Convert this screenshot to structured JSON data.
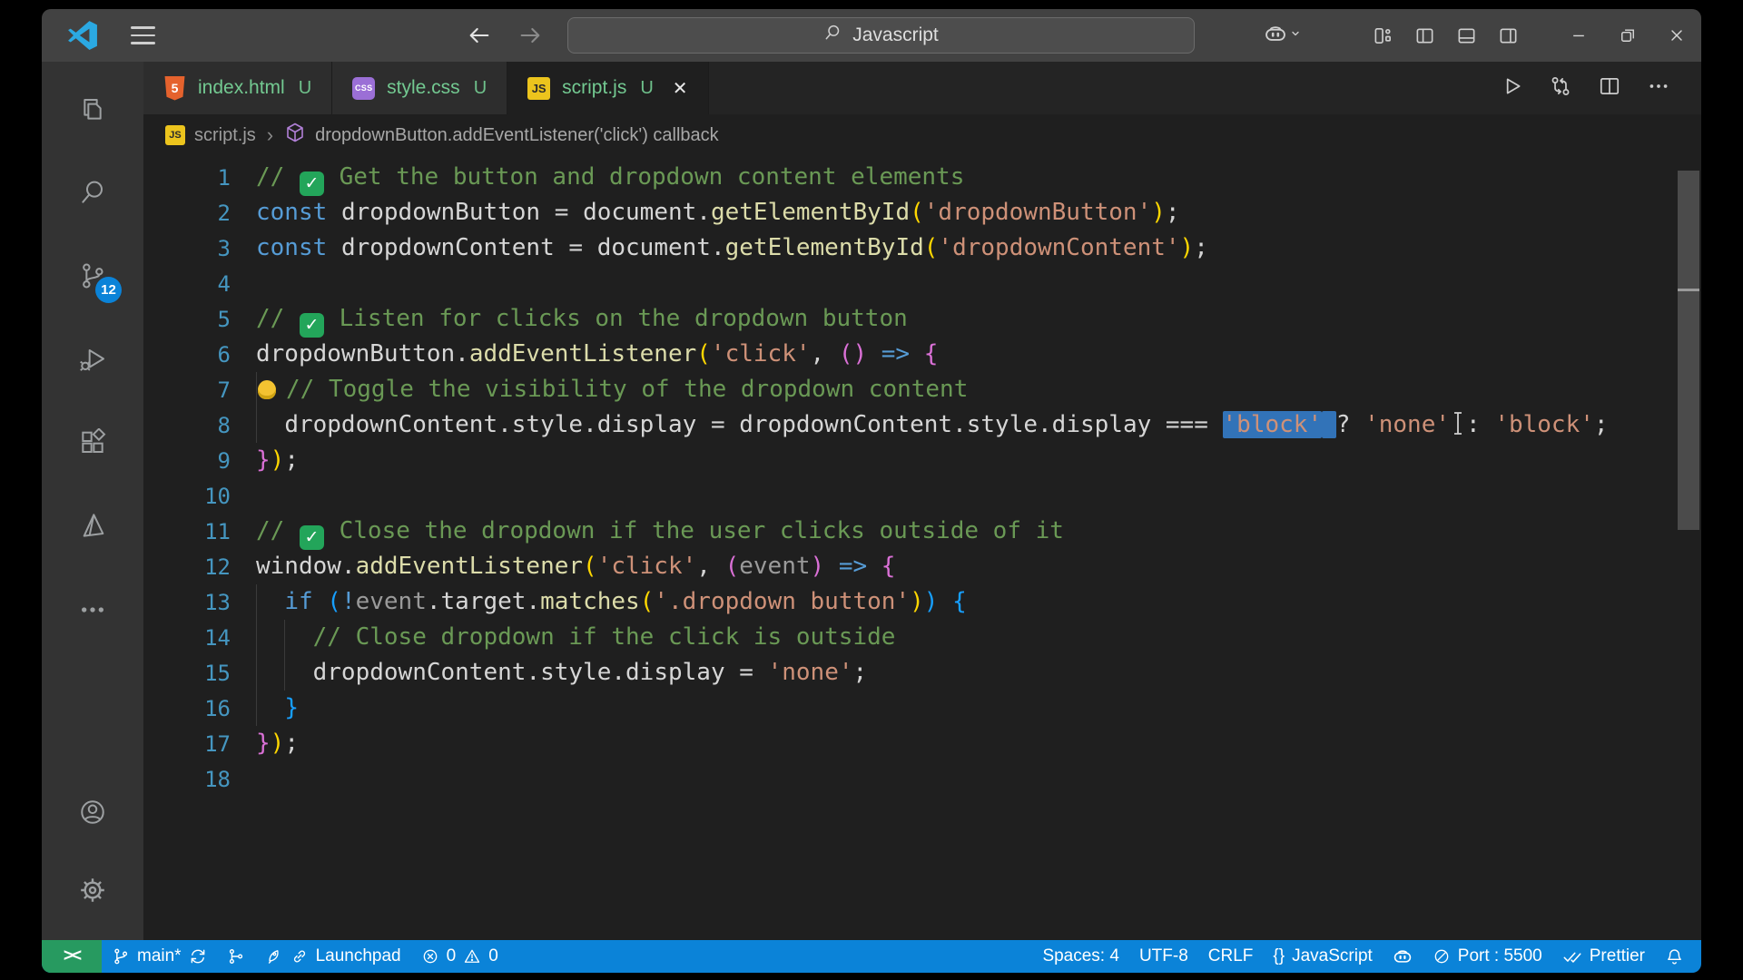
{
  "titlebar": {
    "logo": "vscode-logo",
    "menu_icon": "hamburger-menu-icon",
    "back_icon": "arrow-left-icon",
    "forward_icon": "arrow-right-icon",
    "search": {
      "icon": "search-icon",
      "label": "Javascript"
    },
    "copilot": {
      "icon": "copilot-icon",
      "chevron": "chevron-down-icon"
    },
    "layout_icons": [
      "customize-layout-icon",
      "toggle-sidebar-icon",
      "toggle-panel-icon",
      "toggle-secondary-sidebar-icon"
    ],
    "window_controls": [
      "minimize-icon",
      "restore-icon",
      "close-icon"
    ]
  },
  "activitybar": {
    "items": [
      {
        "name": "explorer",
        "icon": "files-icon"
      },
      {
        "name": "search",
        "icon": "search-icon"
      },
      {
        "name": "source-control",
        "icon": "source-control-icon",
        "badge": "12"
      },
      {
        "name": "run-debug",
        "icon": "run-debug-icon"
      },
      {
        "name": "extensions",
        "icon": "extensions-icon"
      },
      {
        "name": "prism",
        "icon": "prism-icon"
      },
      {
        "name": "more",
        "icon": "ellipsis-icon"
      }
    ],
    "bottom": [
      {
        "name": "accounts",
        "icon": "account-icon"
      },
      {
        "name": "settings",
        "icon": "gear-icon"
      }
    ]
  },
  "tabs": [
    {
      "label": "index.html",
      "status": "U",
      "icon": "html-file-icon",
      "active": false
    },
    {
      "label": "style.css",
      "status": "U",
      "icon": "css-file-icon",
      "active": false
    },
    {
      "label": "script.js",
      "status": "U",
      "icon": "js-file-icon",
      "active": true,
      "close_icon": "close-icon"
    }
  ],
  "editor_actions": [
    "run-icon",
    "open-changes-icon",
    "split-editor-icon",
    "more-actions-icon"
  ],
  "breadcrumb": {
    "file_icon": "js-file-icon",
    "file": "script.js",
    "separator": "›",
    "symbol_icon": "symbol-cube-icon",
    "symbol": "dropdownButton.addEventListener('click') callback"
  },
  "code": {
    "lines": [
      {
        "num": "1",
        "tokens": [
          {
            "t": "// ",
            "c": "cmt"
          },
          {
            "icon": "check"
          },
          {
            "t": " Get the button and dropdown content elements",
            "c": "cmt"
          }
        ]
      },
      {
        "num": "2",
        "tokens": [
          {
            "t": "const",
            "c": "kw"
          },
          {
            "t": " ",
            "c": "op"
          },
          {
            "t": "dropdownButton",
            "c": "var"
          },
          {
            "t": " = ",
            "c": "op"
          },
          {
            "t": "document",
            "c": "var"
          },
          {
            "t": ".",
            "c": "op"
          },
          {
            "t": "getElementById",
            "c": "fn"
          },
          {
            "t": "(",
            "c": "p1"
          },
          {
            "t": "'dropdownButton'",
            "c": "str"
          },
          {
            "t": ")",
            "c": "p1"
          },
          {
            "t": ";",
            "c": "op"
          }
        ]
      },
      {
        "num": "3",
        "tokens": [
          {
            "t": "const",
            "c": "kw"
          },
          {
            "t": " ",
            "c": "op"
          },
          {
            "t": "dropdownContent",
            "c": "var"
          },
          {
            "t": " = ",
            "c": "op"
          },
          {
            "t": "document",
            "c": "var"
          },
          {
            "t": ".",
            "c": "op"
          },
          {
            "t": "getElementById",
            "c": "fn"
          },
          {
            "t": "(",
            "c": "p1"
          },
          {
            "t": "'dropdownContent'",
            "c": "str"
          },
          {
            "t": ")",
            "c": "p1"
          },
          {
            "t": ";",
            "c": "op"
          }
        ]
      },
      {
        "num": "4",
        "tokens": []
      },
      {
        "num": "5",
        "tokens": [
          {
            "t": "// ",
            "c": "cmt"
          },
          {
            "icon": "check"
          },
          {
            "t": " Listen for clicks on the dropdown button",
            "c": "cmt"
          }
        ]
      },
      {
        "num": "6",
        "tokens": [
          {
            "t": "dropdownButton",
            "c": "var"
          },
          {
            "t": ".",
            "c": "op"
          },
          {
            "t": "addEventListener",
            "c": "fn"
          },
          {
            "t": "(",
            "c": "p1"
          },
          {
            "t": "'click'",
            "c": "str"
          },
          {
            "t": ", ",
            "c": "op"
          },
          {
            "t": "()",
            "c": "p2"
          },
          {
            "t": " ",
            "c": "op"
          },
          {
            "t": "=>",
            "c": "arrow"
          },
          {
            "t": " ",
            "c": "op"
          },
          {
            "t": "{",
            "c": "p2"
          }
        ]
      },
      {
        "num": "7",
        "g": [
          0
        ],
        "tokens": [
          {
            "icon": "bulb"
          },
          {
            "t": "// Toggle the visibility of the dropdown content",
            "c": "cmt"
          }
        ]
      },
      {
        "num": "8",
        "g": [
          0
        ],
        "tokens": [
          {
            "t": "  ",
            "c": "op"
          },
          {
            "t": "dropdownContent",
            "c": "var"
          },
          {
            "t": ".",
            "c": "op"
          },
          {
            "t": "style",
            "c": "var"
          },
          {
            "t": ".",
            "c": "op"
          },
          {
            "t": "display",
            "c": "var"
          },
          {
            "t": " = ",
            "c": "op"
          },
          {
            "t": "dropdownContent",
            "c": "var"
          },
          {
            "t": ".",
            "c": "op"
          },
          {
            "t": "style",
            "c": "var"
          },
          {
            "t": ".",
            "c": "op"
          },
          {
            "t": "display",
            "c": "var"
          },
          {
            "t": " ",
            "c": "op"
          },
          {
            "t": "===",
            "c": "op"
          },
          {
            "t": " ",
            "c": "op"
          },
          {
            "t": "'block'",
            "c": "str",
            "sel": true
          },
          {
            "t": " ",
            "c": "op",
            "sel": true
          },
          {
            "t": "?",
            "c": "op"
          },
          {
            "t": " ",
            "c": "op"
          },
          {
            "t": "'none'",
            "c": "str"
          },
          {
            "icon": "ibeam"
          },
          {
            "t": ":",
            "c": "op"
          },
          {
            "t": " ",
            "c": "op"
          },
          {
            "t": "'block'",
            "c": "str"
          },
          {
            "t": ";",
            "c": "op"
          }
        ]
      },
      {
        "num": "9",
        "tokens": [
          {
            "t": "}",
            "c": "p2"
          },
          {
            "t": ")",
            "c": "p1"
          },
          {
            "t": ";",
            "c": "op"
          }
        ]
      },
      {
        "num": "10",
        "tokens": []
      },
      {
        "num": "11",
        "tokens": [
          {
            "t": "// ",
            "c": "cmt"
          },
          {
            "icon": "check"
          },
          {
            "t": " Close the dropdown if the user clicks outside of it",
            "c": "cmt"
          }
        ]
      },
      {
        "num": "12",
        "tokens": [
          {
            "t": "window",
            "c": "var"
          },
          {
            "t": ".",
            "c": "op"
          },
          {
            "t": "addEventListener",
            "c": "fn"
          },
          {
            "t": "(",
            "c": "p1"
          },
          {
            "t": "'click'",
            "c": "str"
          },
          {
            "t": ", ",
            "c": "op"
          },
          {
            "t": "(",
            "c": "p2"
          },
          {
            "t": "event",
            "c": "param"
          },
          {
            "t": ")",
            "c": "p2"
          },
          {
            "t": " ",
            "c": "op"
          },
          {
            "t": "=>",
            "c": "arrow"
          },
          {
            "t": " ",
            "c": "op"
          },
          {
            "t": "{",
            "c": "p2"
          }
        ]
      },
      {
        "num": "13",
        "g": [
          0
        ],
        "tokens": [
          {
            "t": "  ",
            "c": "op"
          },
          {
            "t": "if",
            "c": "kw"
          },
          {
            "t": " ",
            "c": "op"
          },
          {
            "t": "(",
            "c": "p3"
          },
          {
            "t": "!",
            "c": "kw"
          },
          {
            "t": "event",
            "c": "param"
          },
          {
            "t": ".",
            "c": "op"
          },
          {
            "t": "target",
            "c": "var"
          },
          {
            "t": ".",
            "c": "op"
          },
          {
            "t": "matches",
            "c": "fn"
          },
          {
            "t": "(",
            "c": "p1"
          },
          {
            "t": "'.dropdown button'",
            "c": "str"
          },
          {
            "t": ")",
            "c": "p1"
          },
          {
            "t": ")",
            "c": "p3"
          },
          {
            "t": " ",
            "c": "op"
          },
          {
            "t": "{",
            "c": "p3"
          }
        ]
      },
      {
        "num": "14",
        "g": [
          0,
          2
        ],
        "tokens": [
          {
            "t": "    ",
            "c": "op"
          },
          {
            "t": "// Close dropdown if the click is outside",
            "c": "cmt"
          }
        ]
      },
      {
        "num": "15",
        "g": [
          0,
          2
        ],
        "tokens": [
          {
            "t": "    ",
            "c": "op"
          },
          {
            "t": "dropdownContent",
            "c": "var"
          },
          {
            "t": ".",
            "c": "op"
          },
          {
            "t": "style",
            "c": "var"
          },
          {
            "t": ".",
            "c": "op"
          },
          {
            "t": "display",
            "c": "var"
          },
          {
            "t": " = ",
            "c": "op"
          },
          {
            "t": "'none'",
            "c": "str"
          },
          {
            "t": ";",
            "c": "op"
          }
        ]
      },
      {
        "num": "16",
        "g": [
          0
        ],
        "tokens": [
          {
            "t": "  ",
            "c": "op"
          },
          {
            "t": "}",
            "c": "p3"
          }
        ]
      },
      {
        "num": "17",
        "tokens": [
          {
            "t": "}",
            "c": "p2"
          },
          {
            "t": ")",
            "c": "p1"
          },
          {
            "t": ";",
            "c": "op"
          }
        ]
      },
      {
        "num": "18",
        "tokens": []
      }
    ]
  },
  "statusbar": {
    "left": [
      {
        "name": "remote",
        "icon": "remote-icon",
        "label": "><"
      },
      {
        "name": "branch",
        "icon": "git-branch-icon",
        "label": "main*",
        "icon2": "sync-icon"
      },
      {
        "name": "git-graph",
        "icon": "git-graph-icon"
      },
      {
        "name": "launchpad",
        "icons": [
          "rocket-icon",
          "link-icon"
        ],
        "label": "Launchpad"
      },
      {
        "name": "problems",
        "error_icon": "error-icon",
        "error_count": "0",
        "warning_icon": "warning-icon",
        "warning_count": "0"
      }
    ],
    "right": [
      {
        "name": "indentation",
        "label": "Spaces: 4"
      },
      {
        "name": "encoding",
        "label": "UTF-8"
      },
      {
        "name": "eol",
        "label": "CRLF"
      },
      {
        "name": "language",
        "icon": "braces-icon",
        "icon_text": "{}",
        "label": "JavaScript"
      },
      {
        "name": "copilot",
        "icon": "copilot-icon"
      },
      {
        "name": "port",
        "icon": "blocked-icon",
        "label": "Port : 5500"
      },
      {
        "name": "prettier",
        "icon": "double-check-icon",
        "label": "Prettier"
      },
      {
        "name": "notifications",
        "icon": "bell-icon"
      }
    ]
  },
  "colors": {
    "statusbar_bg": "#0b83d8",
    "remote_bg": "#279a60",
    "tab_modified": "#73C991",
    "selection": "#3273b8",
    "badge": "#0b83d8",
    "editor_bg": "#1f1f1f",
    "titlebar_bg": "#424242",
    "activitybar_bg": "#333333"
  }
}
